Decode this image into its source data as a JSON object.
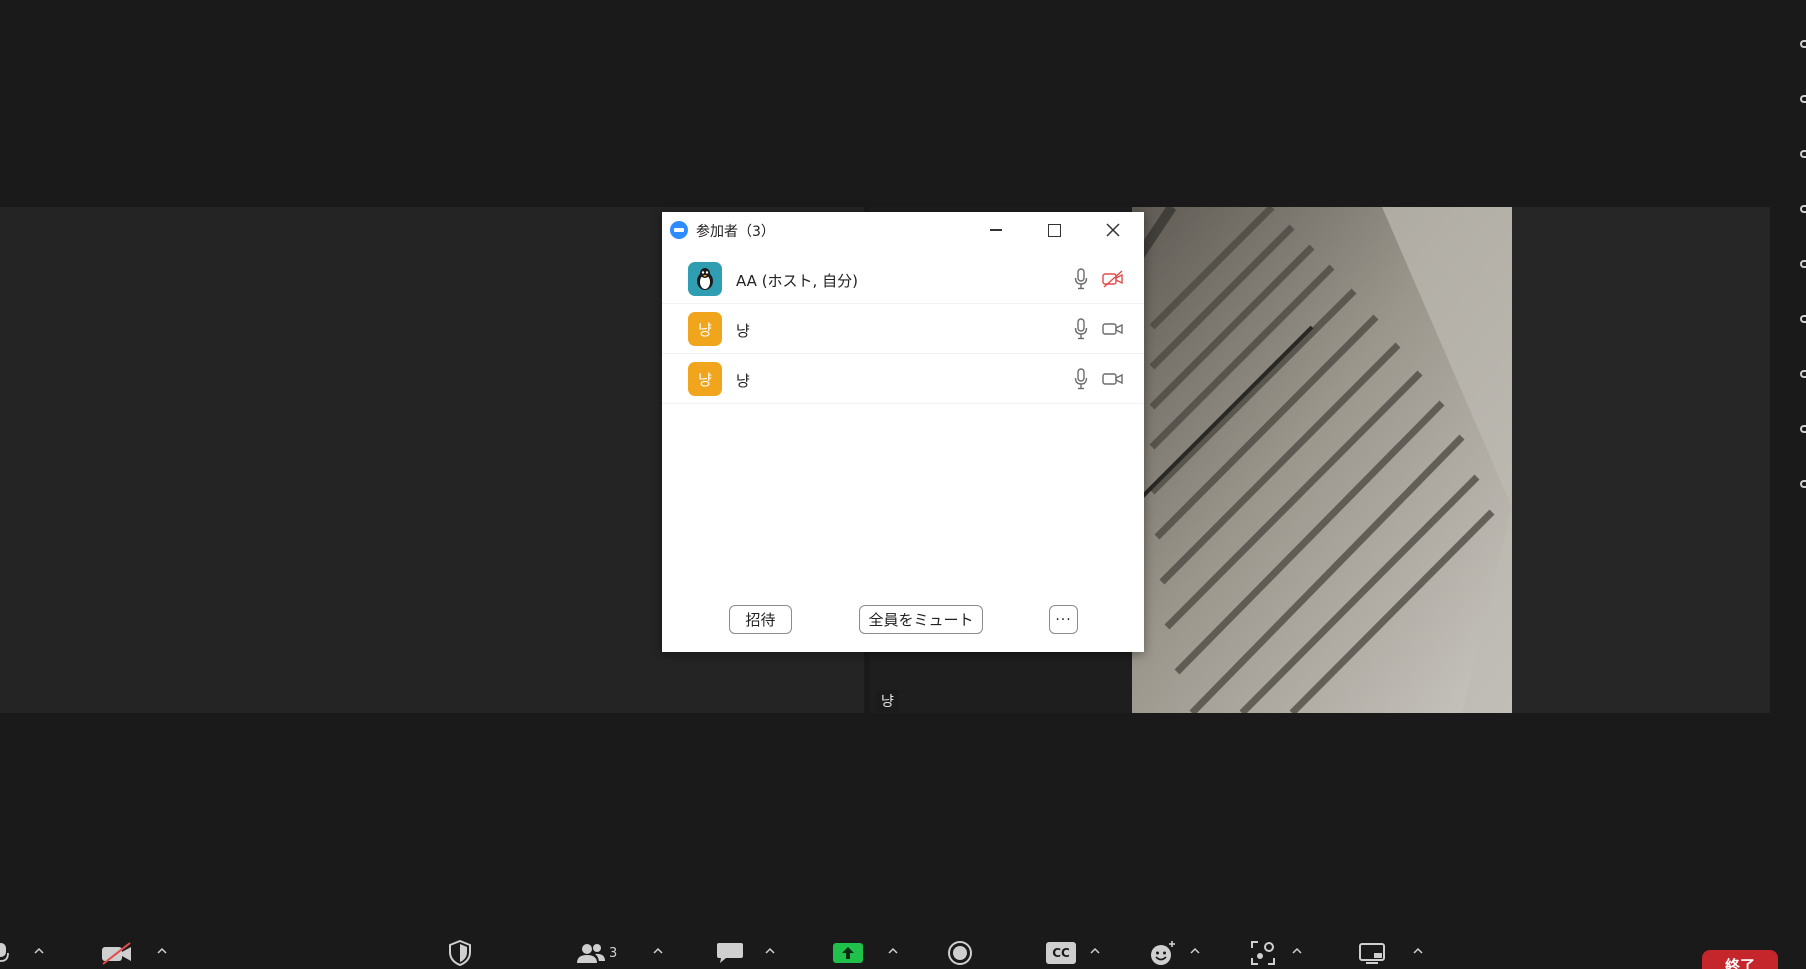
{
  "colors": {
    "background": "#1a1a1a",
    "accent": "#2d8cff",
    "share_green": "#1fc14b",
    "end_red": "#c5262b",
    "muted_red": "#e34b4b",
    "avatar_host": "#2f9db2",
    "avatar_guest": "#f0a51c"
  },
  "gallery": {
    "tile_name": "냥"
  },
  "participants_window": {
    "title": "参加者（3）",
    "icons": [
      "zoom-logo-icon",
      "minimize-icon",
      "maximize-icon",
      "close-icon"
    ],
    "participants": [
      {
        "name": "AA (ホスト, 自分)",
        "avatar": "penguin-icon",
        "mic": "mic-icon",
        "video": "video-off-icon"
      },
      {
        "name": "냥",
        "avatar_text": "냥",
        "mic": "mic-icon",
        "video": "video-icon"
      },
      {
        "name": "냥",
        "avatar_text": "냥",
        "mic": "mic-icon",
        "video": "video-icon"
      }
    ],
    "buttons": {
      "invite": "招待",
      "mute_all": "全員をミュート",
      "more": "···"
    }
  },
  "toolbar": {
    "icons": [
      "mic-icon",
      "video-off-icon",
      "security-shield-icon",
      "participants-icon",
      "chat-icon",
      "share-screen-icon",
      "record-icon",
      "cc-icon",
      "reactions-icon",
      "apps-icon",
      "view-icon"
    ],
    "participants_count": "3",
    "cc_label": "CC",
    "end_label": "終了"
  }
}
